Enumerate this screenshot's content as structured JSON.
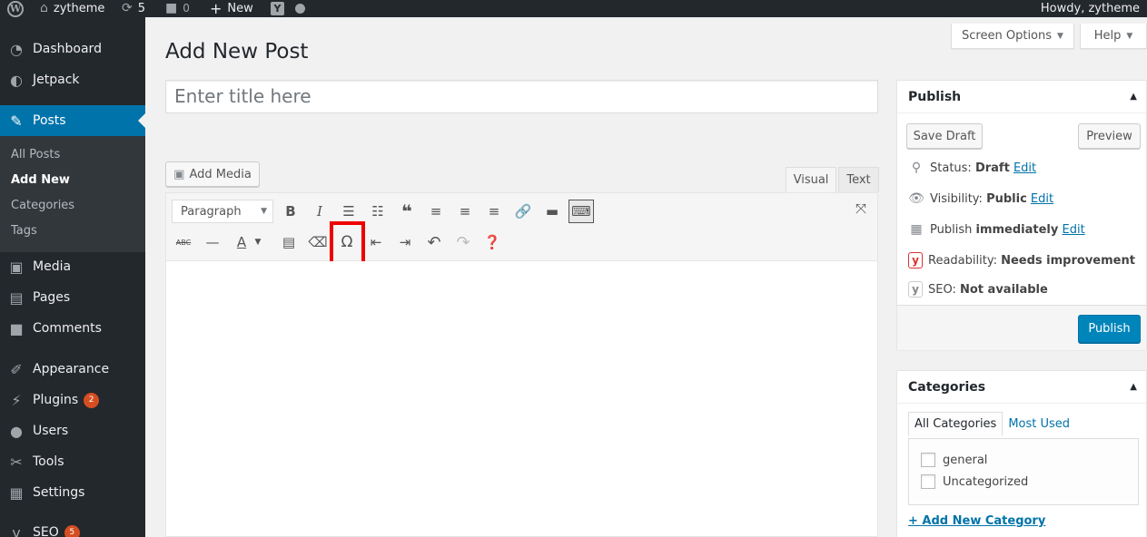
{
  "adminbar": {
    "wp_logo": "W",
    "site_name": "zytheme",
    "updates_count": "5",
    "comments_count": "0",
    "new_label": "New",
    "yoast_label": "Y",
    "howdy": "Howdy, zytheme"
  },
  "menu": {
    "items": [
      {
        "label": "Dashboard",
        "icon": "dashboard-icon"
      },
      {
        "label": "Jetpack",
        "icon": "jetpack-icon"
      },
      {
        "label": "Posts",
        "icon": "pin-icon"
      },
      {
        "label": "Media",
        "icon": "media-icon"
      },
      {
        "label": "Pages",
        "icon": "pages-icon"
      },
      {
        "label": "Comments",
        "icon": "comments-icon"
      },
      {
        "label": "Appearance",
        "icon": "brush-icon"
      },
      {
        "label": "Plugins",
        "icon": "plugin-icon",
        "badge": "2"
      },
      {
        "label": "Users",
        "icon": "users-icon"
      },
      {
        "label": "Tools",
        "icon": "wrench-icon"
      },
      {
        "label": "Settings",
        "icon": "settings-icon"
      },
      {
        "label": "SEO",
        "icon": "yoast-icon",
        "badge": "5"
      }
    ],
    "submenu": [
      "All Posts",
      "Add New",
      "Categories",
      "Tags"
    ]
  },
  "screen_options": {
    "label": "Screen Options"
  },
  "help": {
    "label": "Help"
  },
  "page_title": "Add New Post",
  "title_placeholder": "Enter title here",
  "add_media": "Add Media",
  "editor": {
    "tab_visual": "Visual",
    "tab_text": "Text",
    "format_select": "Paragraph"
  },
  "publish_box": {
    "title": "Publish",
    "save_draft": "Save Draft",
    "preview": "Preview",
    "status_label": "Status:",
    "status_value": "Draft",
    "edit": "Edit",
    "visibility_label": "Visibility:",
    "visibility_value": "Public",
    "publish_label": "Publish",
    "publish_value": "immediately",
    "readability_label": "Readability:",
    "readability_value": "Needs improvement",
    "seo_label": "SEO:",
    "seo_value": "Not available",
    "publish_button": "Publish"
  },
  "categories_box": {
    "title": "Categories",
    "tab_all": "All Categories",
    "tab_most_used": "Most Used",
    "items": [
      "general",
      "Uncategorized"
    ],
    "add_new": "+ Add New Category"
  },
  "colors": {
    "accent": "#0073aa",
    "admin_bg": "#23282d",
    "highlight": "#e00000",
    "readability_icon": "#dc3232"
  }
}
